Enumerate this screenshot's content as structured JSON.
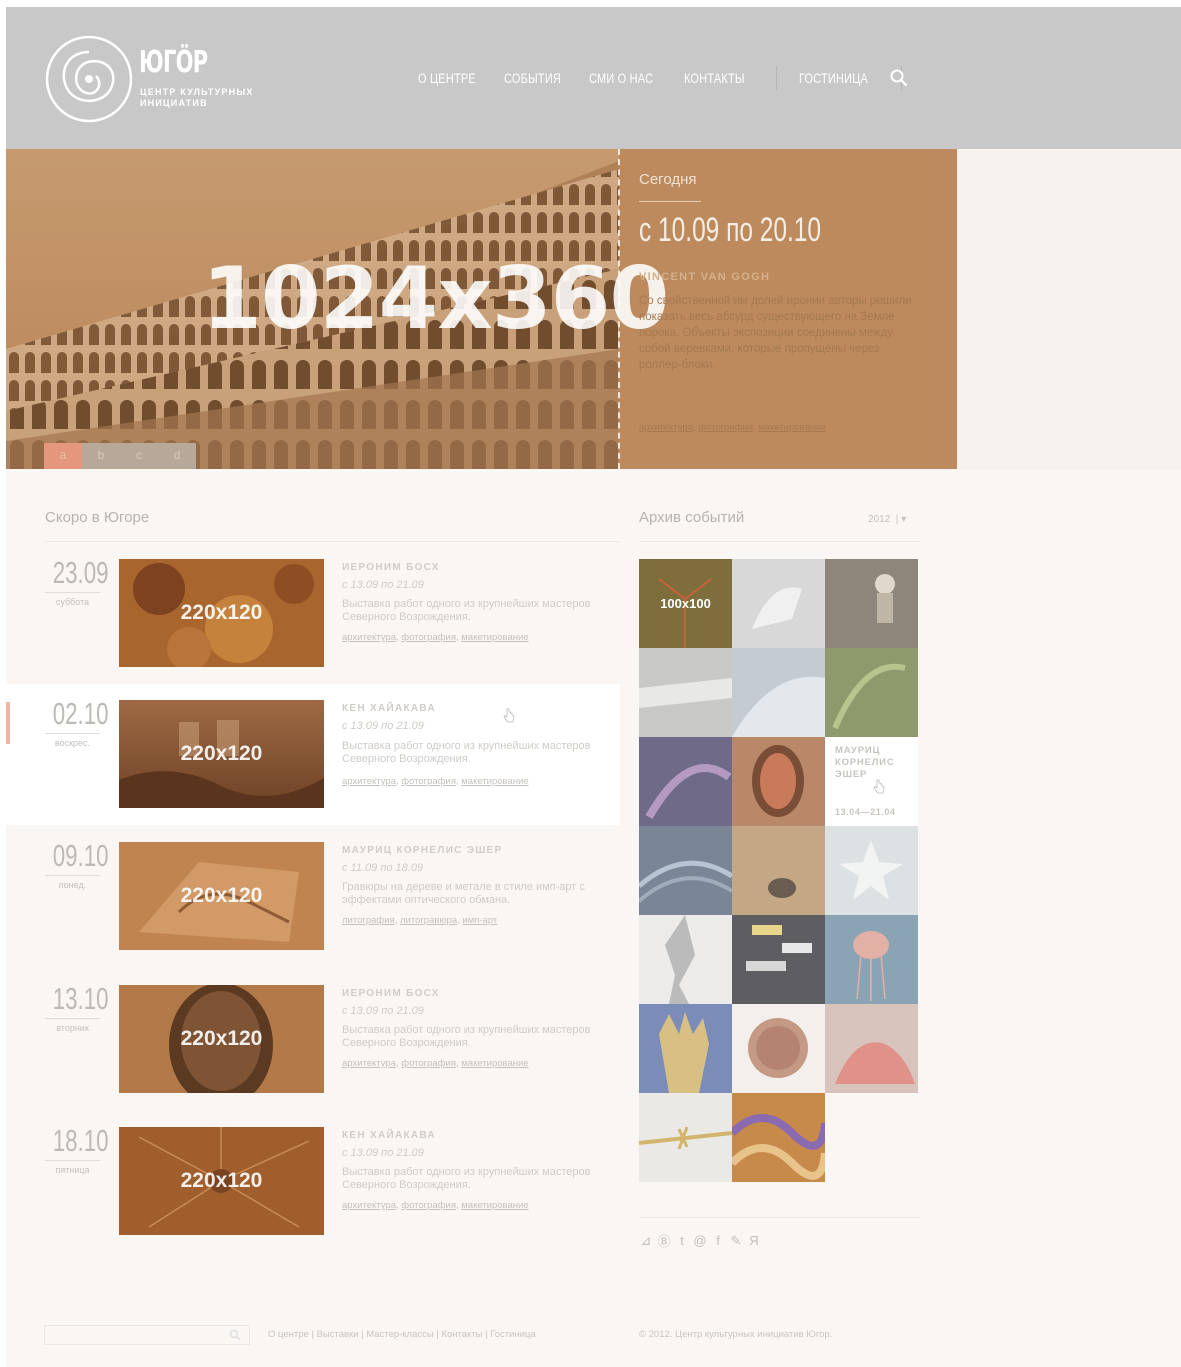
{
  "header": {
    "logo_title": "ЮГӦР",
    "logo_subtitle": "ЦЕНТР КУЛЬТУРНЫХ ИНИЦИАТИВ",
    "nav": [
      "О ЦЕНТРЕ",
      "СОБЫТИЯ",
      "СМИ О НАС",
      "КОНТАКТЫ"
    ],
    "nav_extra": "ГОСТИНИЦА",
    "search_icon": "search-icon"
  },
  "hero": {
    "placeholder": "1024x360",
    "today": "Сегодня",
    "dates": "с 10.09 по 20.10",
    "artist": "VINCENT VAN GOGH",
    "description": "Со свойственной им долей иронии авторы решили показать весь абсурд существующего на Земле порока. Объекты экспозиции соединены между собой веревками, которые пропущены через роллер-блоки.",
    "tags": [
      "архитектура",
      "фотография",
      "макетирование"
    ],
    "tabs": [
      "a",
      "b",
      "c",
      "d"
    ],
    "active_tab": "a",
    "colors": {
      "accent": "#bc8a5c",
      "tab_active": "#e4977c"
    }
  },
  "upcoming": {
    "title": "Скоро в Югоре",
    "events": [
      {
        "date": "23.09",
        "day": "суббота",
        "placeholder": "220x120",
        "title": "ИЕРОНИМ БОСХ",
        "period": "с 13.09 по 21.09",
        "description": "Выставка работ одного из крупнейших мастеров Северного Возрождения.",
        "tags": [
          "архитектура",
          "фотография",
          "макетирование"
        ]
      },
      {
        "date": "02.10",
        "day": "воскрес.",
        "placeholder": "220x120",
        "title": "КЕН ХАЙАКАВА",
        "period": "с 13.09 по 21.09",
        "description": "Выставка работ одного из крупнейших мастеров Северного Возрождения.",
        "tags": [
          "архитектура",
          "фотография",
          "макетирование"
        ]
      },
      {
        "date": "09.10",
        "day": "понед.",
        "placeholder": "220x120",
        "title": "МАУРИЦ КОРНЕЛИС ЭШЕР",
        "period": "с 11.09 по 18.09",
        "description": "Гравюры на дереве и метале в стиле имп-арт с эффектами оптического обмана.",
        "tags": [
          "литография",
          "литогравюра",
          "имп-арт"
        ]
      },
      {
        "date": "13.10",
        "day": "вторник",
        "placeholder": "220x120",
        "title": "ИЕРОНИМ БОСХ",
        "period": "с 13.09 по 21.09",
        "description": "Выставка работ одного из крупнейших мастеров Северного Возрождения.",
        "tags": [
          "архитектура",
          "фотография",
          "макетирование"
        ]
      },
      {
        "date": "18.10",
        "day": "пятница",
        "placeholder": "220x120",
        "title": "КЕН ХАЙАКАВА",
        "period": "с 13.09 по 21.09",
        "description": "Выставка работ одного из крупнейших мастеров Северного Возрождения.",
        "tags": [
          "архитектура",
          "фотография",
          "макетирование"
        ]
      }
    ]
  },
  "archive": {
    "title": "Архив событий",
    "year": "2012",
    "placeholder": "100x100",
    "hover_title": "МАУРИЦ КОРНЕЛИС ЭШЕР",
    "hover_dates": "13.04—21.04"
  },
  "social": [
    "rss-icon",
    "blogger-icon",
    "tumblr-icon",
    "mail-icon",
    "facebook-icon",
    "livejournal-icon",
    "yandex-icon"
  ],
  "footer": {
    "links": [
      "О центре",
      "Выставки",
      "Мастер-классы",
      "Контакты",
      "Гостиница"
    ],
    "copyright": "© 2012. Центр культурных инициатив Югор."
  }
}
